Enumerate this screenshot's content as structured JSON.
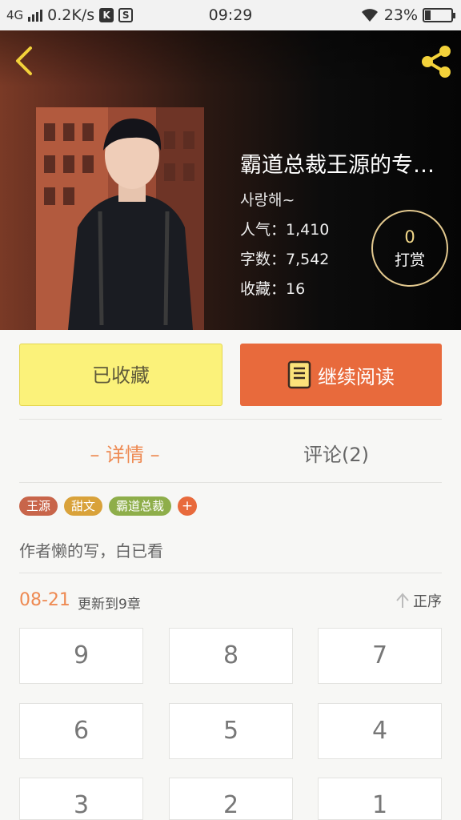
{
  "status_bar": {
    "network": "4G",
    "speed": "0.2K/s",
    "icon_k": "K",
    "icon_s": "S",
    "time": "09:29",
    "battery": "23%",
    "battery_level": 0.23
  },
  "header": {
    "back_icon": "chevron-left-icon",
    "share_icon": "share-icon",
    "accent_color": "#f3d23a"
  },
  "book": {
    "title": "霸道总裁王源的专…",
    "author": "사랑해~",
    "popularity": "人气：1,410",
    "word_count": "字数：7,542",
    "favorites": "收藏：16",
    "tip_count": "0",
    "tip_label": "打赏"
  },
  "actions": {
    "collect_label": "已收藏",
    "read_label": "继续阅读",
    "read_icon": "book-icon",
    "collect_color": "#fbf27a",
    "read_color": "#e86a3c"
  },
  "tabs": [
    {
      "label": "– 详情 –"
    },
    {
      "label": "评论(2)"
    }
  ],
  "tags": [
    {
      "label": "王源",
      "color": "#c8654a"
    },
    {
      "label": "甜文",
      "color": "#d9a23a"
    },
    {
      "label": "霸道总裁",
      "color": "#8eae4a"
    },
    {
      "label": "+",
      "color": "#e86a3c"
    }
  ],
  "description": "作者懒的写，白已看",
  "update": {
    "date": "08-21",
    "text": "更新到9章",
    "sort_label": "正序",
    "sort_icon": "arrow-up-icon"
  },
  "chapters": [
    "9",
    "8",
    "7",
    "6",
    "5",
    "4",
    "3",
    "2",
    "1"
  ]
}
